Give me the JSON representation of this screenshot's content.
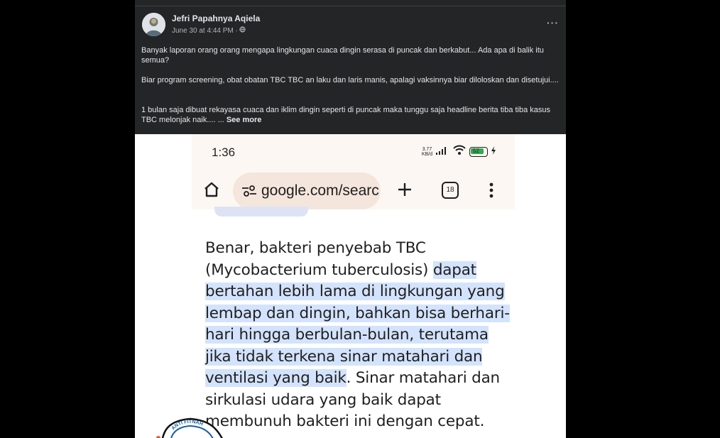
{
  "post": {
    "author": "Jefri Papahnya Aqiela",
    "timestamp": "June 30 at 4:44 PM ·",
    "privacy_icon": "globe-icon",
    "more_label": "···",
    "paragraphs": [
      "Banyak laporan orang orang mengapa lingkungan cuaca dingin serasa di puncak dan berkabut... Ada apa di balik itu semua?",
      "Biar program screening, obat obatan TBC TBC an laku dan laris manis, apalagi vaksinnya biar diloloskan dan disetujui....",
      "1 bulan saja dibuat rekayasa cuaca dan iklim dingin seperti di puncak maka tunggu saja headline berita tiba tiba kasus TBC melonjak naik.... ..."
    ],
    "see_more": "See more"
  },
  "screenshot": {
    "time": "1:36",
    "net_speed_top": "3.77",
    "net_speed_bottom": "KB/d",
    "battery": "52",
    "url": "google.com/search",
    "tab_count": "18",
    "answer_plain_1": "Benar, bakteri penyebab TBC (Mycobacterium tuberculosis) ",
    "answer_highlight": "dapat bertahan lebih lama di lingkungan yang lembap dan dingin, bahkan bisa berhari-hari hingga berbulan-bulan, terutama jika tidak terkena sinar matahari dan ventilasi yang baik",
    "answer_plain_2": ". Sinar matahari dan sirkulasi udara yang baik dapat membunuh bakteri ini dengan cepat."
  },
  "watermark": {
    "stamp_text": "ANTI FITNAH"
  },
  "colors": {
    "page_bg": "#000000",
    "post_bg": "#242526",
    "highlight": "#d3e3fd",
    "url_pill": "#f4e6dc"
  }
}
